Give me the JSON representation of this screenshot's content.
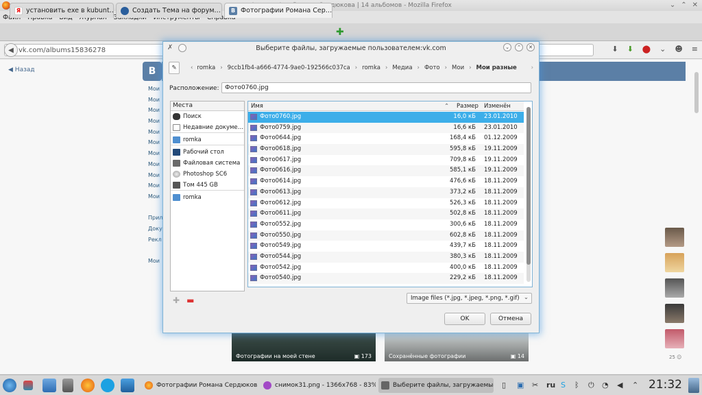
{
  "window": {
    "title": "Фотографии Романа Сердюкова | 14 альбомов - Mozilla Firefox"
  },
  "menu": [
    "Файл",
    "Правка",
    "Вид",
    "Журнал",
    "Закладки",
    "Инструменты",
    "Справка"
  ],
  "tabs": [
    {
      "label": "установить exe в kubunt…",
      "icon": "yandex-icon",
      "active": false
    },
    {
      "label": "Создать Тема на форум…",
      "icon": "ubuntu-icon",
      "active": false
    },
    {
      "label": "Фотографии Романа Сер…",
      "icon": "vk-icon",
      "active": true
    }
  ],
  "urlbar": {
    "value": "vk.com/albums15836278"
  },
  "vk": {
    "back_label": "Назад",
    "logo": "B",
    "side_items": [
      "Мои",
      "Мои",
      "Мои",
      "Мои",
      "Мои",
      "Мои",
      "Мои",
      "Мои",
      "Мои",
      "Мои",
      "Мои",
      "",
      "Прил",
      "Доку",
      "Рекл",
      "",
      "Мои"
    ],
    "albums": [
      {
        "caption": "Фотографии на моей стене",
        "count": "173"
      },
      {
        "caption": "Сохранённые фотографии",
        "count": "14"
      }
    ],
    "friends_count": "25"
  },
  "dialog": {
    "title": "Выберите файлы, загружаемые пользователем:vk.com",
    "breadcrumbs": [
      "romka",
      "9ccb1fb4-a666-4774-9ae0-192566c037ca",
      "romka",
      "Медиа",
      "Фото",
      "Мои"
    ],
    "current_folder": "Мои разные",
    "location_label": "Расположение:",
    "location_value": "Фото0760.jpg",
    "places_header": "Места",
    "places": [
      {
        "label": "Поиск",
        "icon": "binoculars-icon"
      },
      {
        "label": "Недавние докуме…",
        "icon": "recent-icon"
      },
      {
        "label": "romka",
        "icon": "home-folder-icon"
      },
      {
        "label": "Рабочий стол",
        "icon": "desktop-icon"
      },
      {
        "label": "Файловая система",
        "icon": "filesystem-icon"
      },
      {
        "label": "Photoshop SC6",
        "icon": "disc-icon"
      },
      {
        "label": "Том 445 GB",
        "icon": "drive-icon"
      },
      {
        "label": "romka",
        "icon": "folder-icon"
      }
    ],
    "columns": {
      "name": "Имя",
      "size": "Размер",
      "modified": "Изменён"
    },
    "files": [
      {
        "name": "Фото0760.jpg",
        "size": "16,0 кБ",
        "date": "23.01.2010",
        "selected": true
      },
      {
        "name": "Фото0759.jpg",
        "size": "16,6 кБ",
        "date": "23.01.2010"
      },
      {
        "name": "Фото0644.jpg",
        "size": "168,4 кБ",
        "date": "01.12.2009"
      },
      {
        "name": "Фото0618.jpg",
        "size": "595,8 кБ",
        "date": "19.11.2009"
      },
      {
        "name": "Фото0617.jpg",
        "size": "709,8 кБ",
        "date": "19.11.2009"
      },
      {
        "name": "Фото0616.jpg",
        "size": "585,1 кБ",
        "date": "19.11.2009"
      },
      {
        "name": "Фото0614.jpg",
        "size": "476,6 кБ",
        "date": "18.11.2009"
      },
      {
        "name": "Фото0613.jpg",
        "size": "373,2 кБ",
        "date": "18.11.2009"
      },
      {
        "name": "Фото0612.jpg",
        "size": "526,3 кБ",
        "date": "18.11.2009"
      },
      {
        "name": "Фото0611.jpg",
        "size": "502,8 кБ",
        "date": "18.11.2009"
      },
      {
        "name": "Фото0552.jpg",
        "size": "300,6 кБ",
        "date": "18.11.2009"
      },
      {
        "name": "Фото0550.jpg",
        "size": "602,8 кБ",
        "date": "18.11.2009"
      },
      {
        "name": "Фото0549.jpg",
        "size": "439,7 кБ",
        "date": "18.11.2009"
      },
      {
        "name": "Фото0544.jpg",
        "size": "380,3 кБ",
        "date": "18.11.2009"
      },
      {
        "name": "Фото0542.jpg",
        "size": "400,0 кБ",
        "date": "18.11.2009"
      },
      {
        "name": "Фото0540.jpg",
        "size": "229,2 кБ",
        "date": "18.11.2009"
      }
    ],
    "filter": "Image files (*.jpg, *.jpeg, *.png, *.gif)",
    "ok_label": "OK",
    "cancel_label": "Отмена"
  },
  "taskbar": {
    "tasks": [
      {
        "label": "Фотографии Романа Сердюкова",
        "icon": "firefox-icon"
      },
      {
        "label": "снимок31.png - 1366x768 - 83%…",
        "icon": "image-viewer-icon"
      },
      {
        "label": "Выберите файлы, загружаемые …",
        "icon": "dialog-icon"
      }
    ],
    "keyboard_layout": "ru",
    "clock": "21:32"
  },
  "colors": {
    "selection": "#3daee9",
    "vk_blue": "#5b7fa6",
    "accent_border": "#7fb3d6"
  }
}
